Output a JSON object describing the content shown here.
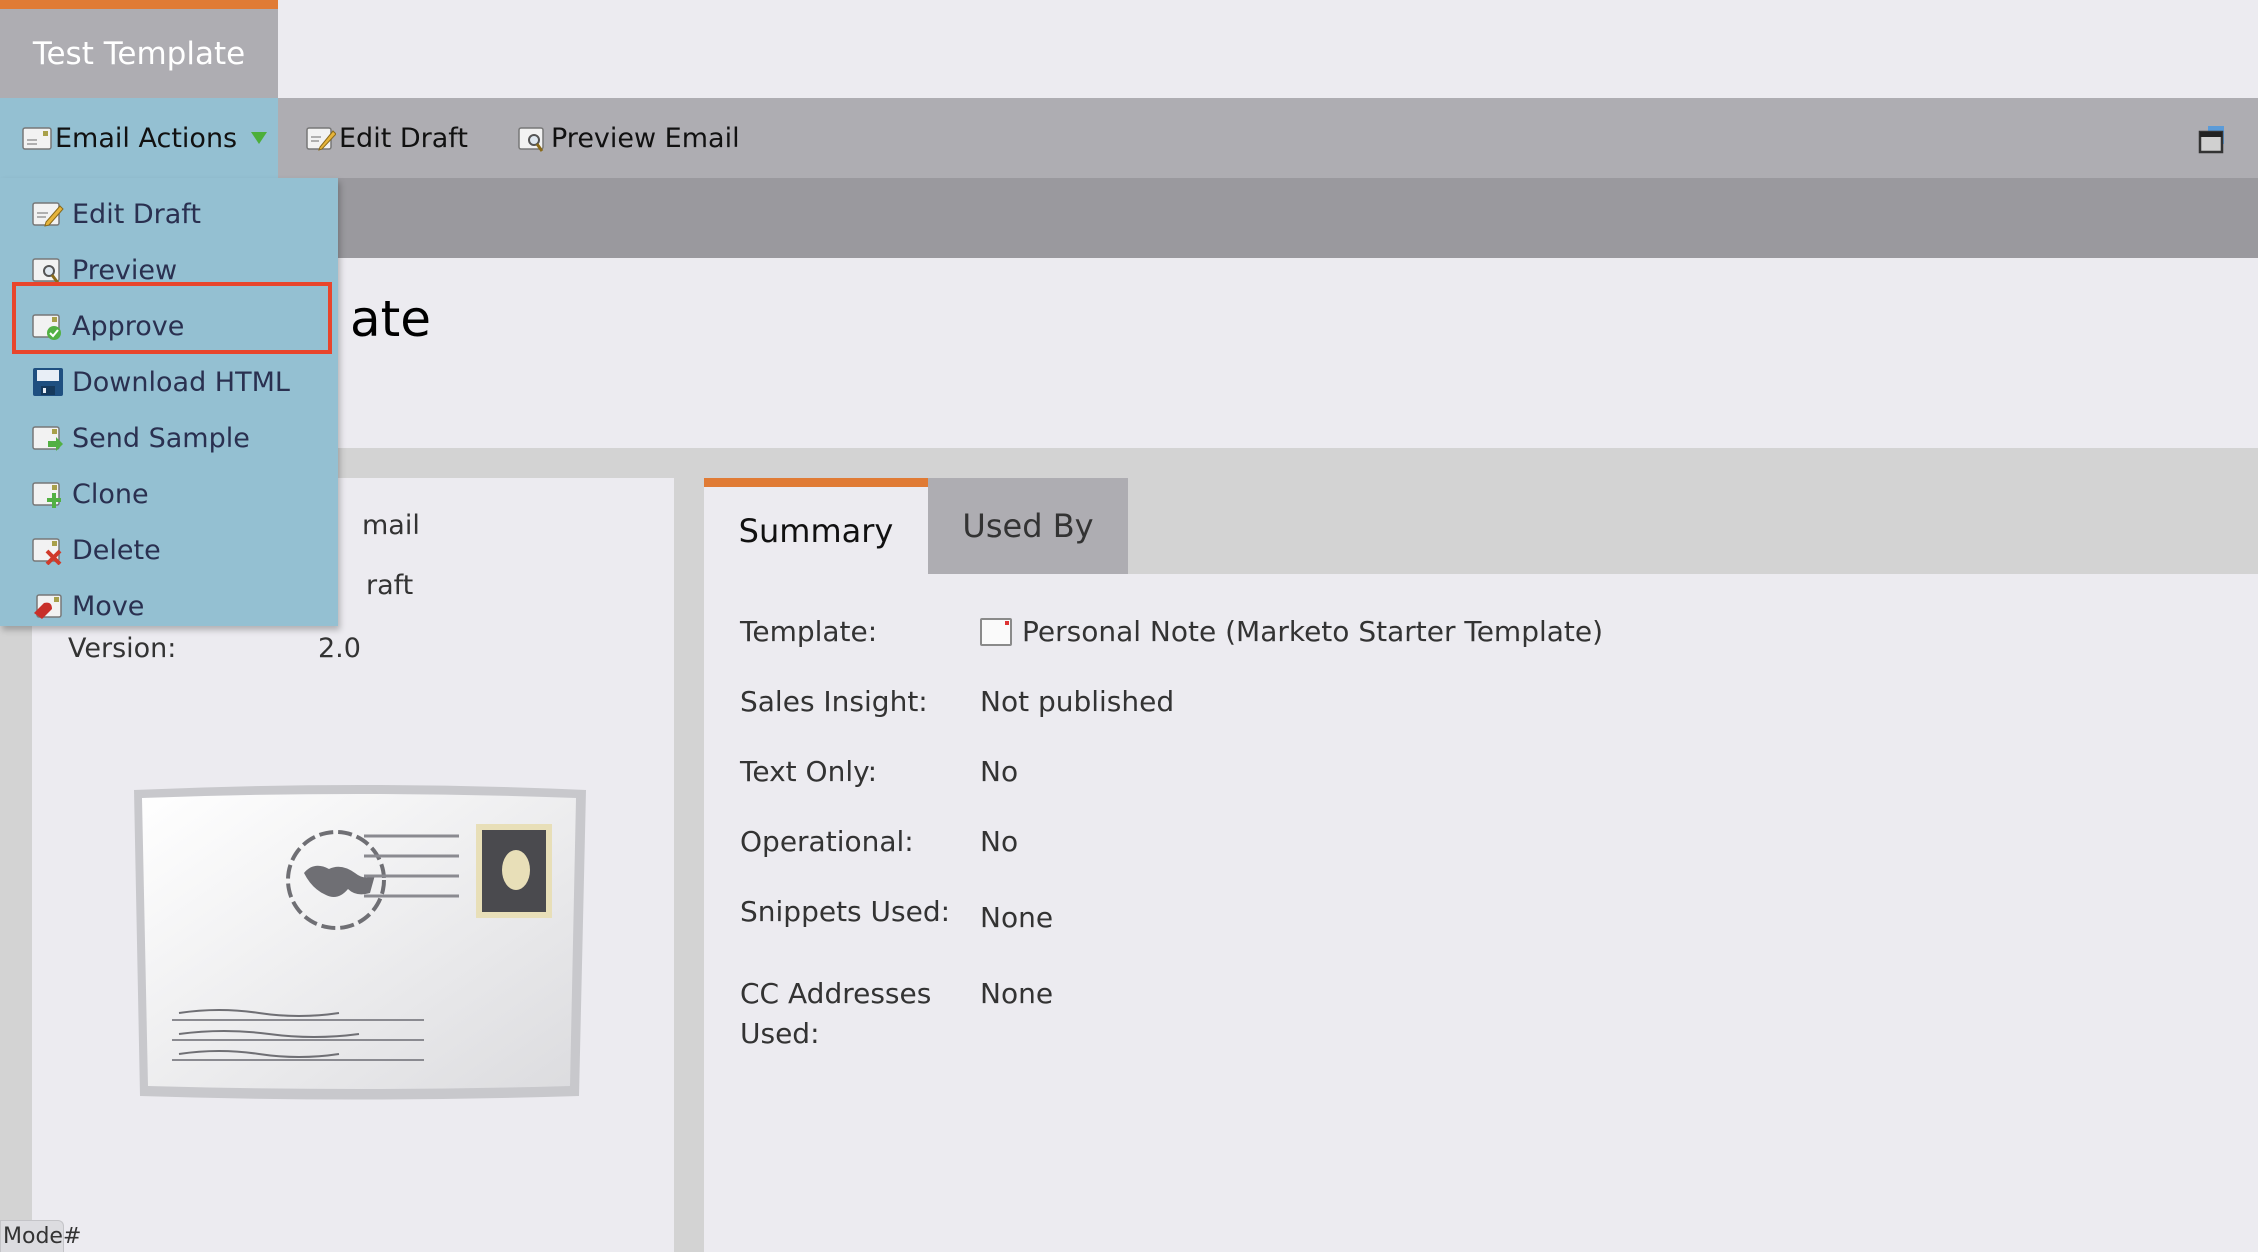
{
  "document_tab": {
    "title": "Test Template"
  },
  "toolbar": {
    "email_actions_label": "Email Actions",
    "edit_draft_label": "Edit Draft",
    "preview_email_label": "Preview Email"
  },
  "email_actions_menu": {
    "items": [
      {
        "label": "Edit Draft",
        "icon": "edit-draft-icon"
      },
      {
        "label": "Preview",
        "icon": "preview-icon"
      },
      {
        "label": "Approve",
        "icon": "approve-icon",
        "highlighted": true
      },
      {
        "label": "Download HTML",
        "icon": "floppy-disk-icon"
      },
      {
        "label": "Send Sample",
        "icon": "send-sample-icon"
      },
      {
        "label": "Clone",
        "icon": "clone-icon"
      },
      {
        "label": "Delete",
        "icon": "delete-icon"
      },
      {
        "label": "Move",
        "icon": "move-icon"
      }
    ]
  },
  "asset": {
    "title_visible_fragment": "ate"
  },
  "left_panel": {
    "rows": [
      {
        "label": "",
        "value": "mail"
      },
      {
        "label": "",
        "value": "raft"
      },
      {
        "label": "Version:",
        "value": "2.0"
      }
    ]
  },
  "tabs": [
    {
      "label": "Summary",
      "active": true
    },
    {
      "label": "Used By",
      "active": false
    }
  ],
  "summary": {
    "template_label": "Template:",
    "template_value": "Personal Note (Marketo Starter Template)",
    "sales_insight_label": "Sales Insight:",
    "sales_insight_value": "Not published",
    "text_only_label": "Text Only:",
    "text_only_value": "No",
    "operational_label": "Operational:",
    "operational_value": "No",
    "snippets_label": "Snippets Used:",
    "snippets_value": "None",
    "cc_label_line1": "CC Addresses",
    "cc_label_line2": "Used:",
    "cc_value": "None"
  },
  "footer": {
    "mode_label": "Mode#"
  },
  "colors": {
    "accent_orange": "#e07b35",
    "menu_blue": "#94c0d2",
    "highlight_red": "#e8452c",
    "toolbar_gray": "#aeadb2"
  }
}
